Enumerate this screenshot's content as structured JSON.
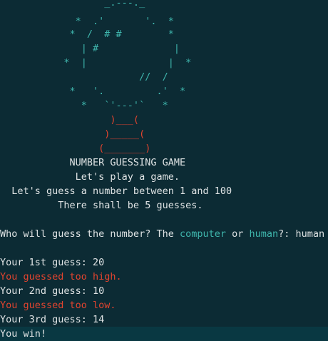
{
  "ascii_art": {
    "balloon": [
      "                  _.---._",
      "             *  .'       '.  *",
      "            *  /  # #        *",
      "              | #             |",
      "           *  |              |  *",
      "                        //  /",
      "            *   '.         .'  *",
      "              *   `'---'`   *"
    ],
    "basket": [
      "                   )___(",
      "                  )_____(",
      "                 (_______)"
    ]
  },
  "banner": {
    "title": "            NUMBER GUESSING GAME",
    "line1": "             Let's play a game.",
    "line2": "  Let's guess a number between 1 and 100",
    "line3": "          There shall be 5 guesses."
  },
  "prompt": {
    "pre": "Who will guess the number? The ",
    "opt1": "computer",
    "mid": " or ",
    "opt2": "human",
    "post": "?: human"
  },
  "log": [
    {
      "text": "Your 1st guess: 20",
      "kind": "white"
    },
    {
      "text": "You guessed too high.",
      "kind": "red"
    },
    {
      "text": "Your 2nd guess: 10",
      "kind": "white"
    },
    {
      "text": "You guessed too low.",
      "kind": "red"
    },
    {
      "text": "Your 3rd guess: 14",
      "kind": "white"
    },
    {
      "text": "You win!",
      "kind": "white"
    }
  ],
  "colors": {
    "background": "#0c2b34",
    "text": "#dfe3e4",
    "accent_cyan": "#3fb6ad",
    "accent_red": "#e2442f",
    "current_line": "#093842"
  }
}
